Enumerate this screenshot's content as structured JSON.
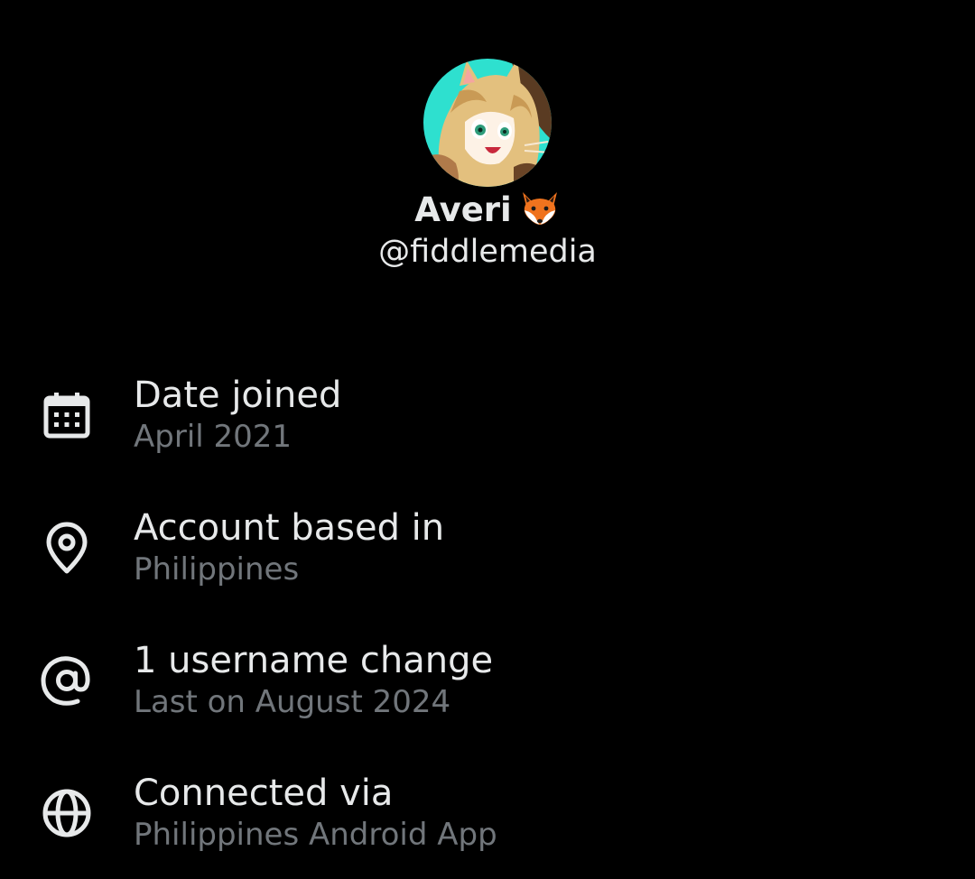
{
  "profile": {
    "display_name": "Averi",
    "name_emoji": "fox-emoji",
    "handle": "@fiddlemedia"
  },
  "about": {
    "items": [
      {
        "icon": "calendar-icon",
        "title": "Date joined",
        "subtitle": "April 2021"
      },
      {
        "icon": "location-pin-icon",
        "title": "Account based in",
        "subtitle": "Philippines"
      },
      {
        "icon": "at-sign-icon",
        "title": "1 username change",
        "subtitle": "Last on August 2024"
      },
      {
        "icon": "globe-icon",
        "title": "Connected via",
        "subtitle": "Philippines Android App"
      }
    ]
  },
  "colors": {
    "background": "#000000",
    "primary_text": "#e7e9ea",
    "secondary_text": "#71767b",
    "avatar_background": "#2ee0cf"
  }
}
